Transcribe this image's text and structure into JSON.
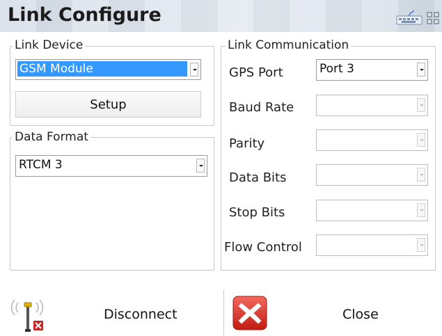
{
  "window": {
    "title": "Link Configure"
  },
  "link_device": {
    "legend": "Link Device",
    "device_value": "GSM Module",
    "setup_label": "Setup"
  },
  "data_format": {
    "legend": "Data Format",
    "format_value": "RTCM 3"
  },
  "link_communication": {
    "legend": "Link Communication",
    "rows": [
      {
        "label": "GPS Port",
        "value": "Port 3",
        "enabled": true
      },
      {
        "label": "Baud Rate",
        "value": "",
        "enabled": false
      },
      {
        "label": "Parity",
        "value": "",
        "enabled": false
      },
      {
        "label": "Data Bits",
        "value": "",
        "enabled": false
      },
      {
        "label": "Stop Bits",
        "value": "",
        "enabled": false
      },
      {
        "label": "Flow Control",
        "value": "",
        "enabled": false
      }
    ]
  },
  "actions": {
    "disconnect_label": "Disconnect",
    "close_label": "Close"
  },
  "icons": {
    "keyboard": "keyboard-icon",
    "title_close": "close-icon",
    "disconnect": "antenna-disconnect-icon",
    "close": "red-x-close-icon"
  },
  "colors": {
    "selection": "#3399ff",
    "close_red": "#d93025"
  }
}
